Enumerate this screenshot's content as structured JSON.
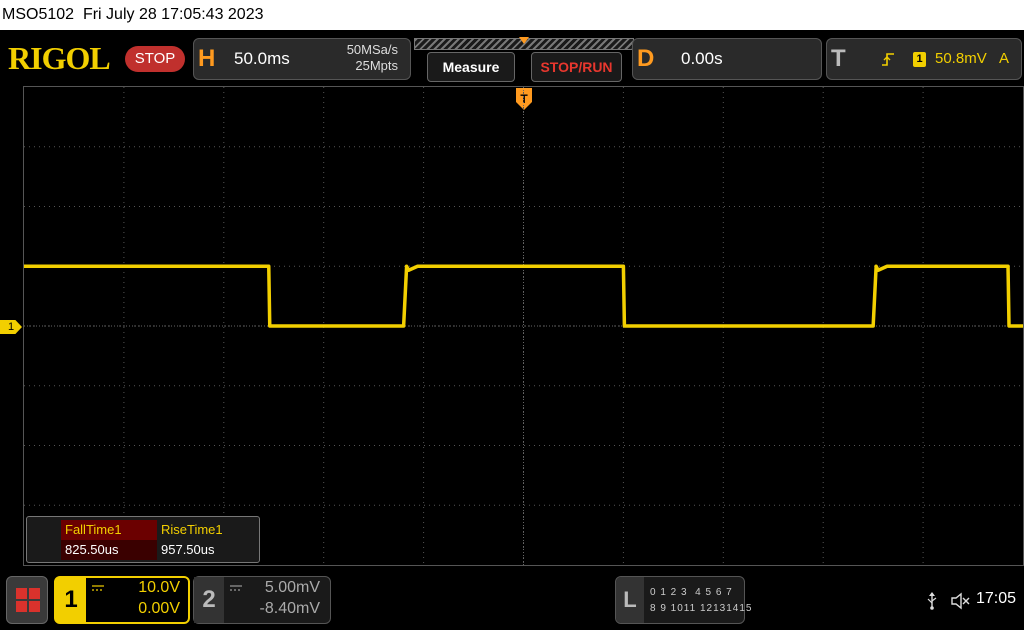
{
  "title_bar": {
    "model": "MSO5102",
    "datetime": "Fri July 28 17:05:43 2023"
  },
  "header": {
    "logo_text": "RIGOL",
    "run_state": "STOP",
    "horizontal": {
      "letter": "H",
      "timebase": "50.0ms",
      "sample_rate": "50MSa/s",
      "memory_depth": "25Mpts"
    },
    "measure_label": "Measure",
    "stop_run_label": "STOP/RUN",
    "delay": {
      "letter": "D",
      "value": "0.00s"
    },
    "trigger": {
      "letter": "T",
      "source": "1",
      "level": "50.8mV",
      "mode": "A"
    }
  },
  "waveform": {
    "channel_marker": "1",
    "ch1_color": "#f2cf00",
    "grid_divisions": {
      "x": 10,
      "y": 8
    },
    "trace_y_high_div": 1.0,
    "trace_y_low_div": 0.0,
    "edges": [
      {
        "x_div": -5.0,
        "level": "high"
      },
      {
        "x_div": -2.55,
        "level": "low"
      },
      {
        "x_div": -1.2,
        "level": "high"
      },
      {
        "x_div": 1.0,
        "level": "low"
      },
      {
        "x_div": 3.5,
        "level": "high"
      },
      {
        "x_div": 4.85,
        "level": "low"
      }
    ]
  },
  "measurements": [
    {
      "name": "FallTime1",
      "value": "825.50us"
    },
    {
      "name": "RiseTime1",
      "value": "957.50us"
    }
  ],
  "bottom": {
    "ch1": {
      "number": "1",
      "scale": "10.0V",
      "offset": "0.00V"
    },
    "ch2": {
      "number": "2",
      "scale": "5.00mV",
      "offset": "-8.40mV"
    },
    "la": {
      "letter": "L",
      "row1": "0 1 2 3  4 5 6 7",
      "row2": "8 9 1011 12131415"
    },
    "time": "17:05"
  }
}
